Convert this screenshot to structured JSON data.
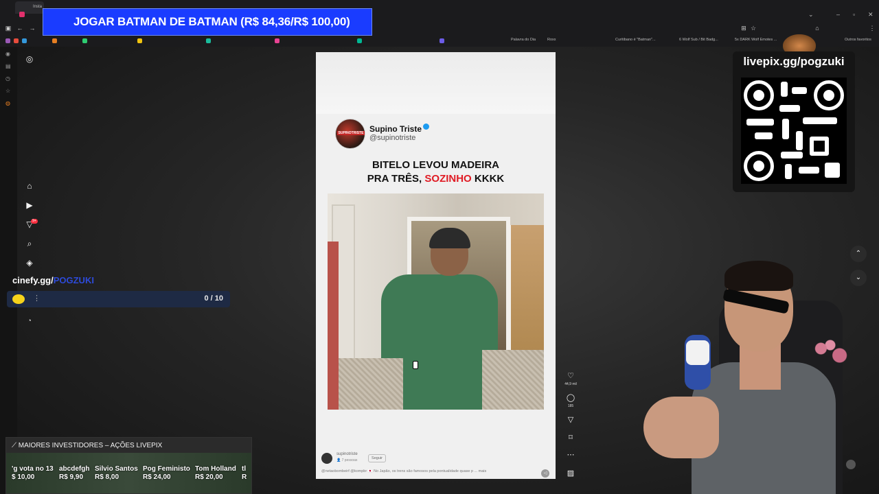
{
  "browser": {
    "tab_title": "Insta",
    "bookmarks": [
      "Palavra do Dia",
      "Roxx",
      "Curitibano é \"Batman\"...",
      "6 Wolf Sub / Bit Badg...",
      "5x DARK Wolf Emotes ...",
      "Outros favoritos"
    ]
  },
  "alert": {
    "text": "JOGAR BATMAN DE BATMAN (R$ 84,36/R$ 100,00)"
  },
  "overlay": {
    "cinefy_text": "cinefy.gg/",
    "cinefy_hidden": "POGZUKI",
    "goal_progress": "0  /  10",
    "qr_title": "livepix.gg/pogzuki"
  },
  "post": {
    "author_name": "Supino Triste",
    "author_handle": "@supinotriste",
    "avatar_text": "SUPINOTRISTE",
    "headline_line1": "BITELO LEVOU MADEIRA",
    "headline_line2_a": "PRA TRÊS, ",
    "headline_line2_red": "SOZINHO",
    "headline_line2_b": " KKKK",
    "footer_user": "supinotriste",
    "footer_sub": "👤 7 pessoas",
    "follow_label": "Seguir",
    "caption": "@netaobombeirf @kompbr 🇯🇵 No Japão, os trens são famosos pela pontualidade quase p ... mais"
  },
  "actions": {
    "like_count": "44,9 mil",
    "comment_count": "185"
  },
  "ticker": {
    "header": "MAIORES INVESTIDORES – AÇÕES LIVEPIX",
    "items": [
      {
        "name": "'g vota no 13",
        "value": "$ 10,00"
      },
      {
        "name": "abcdefgh",
        "value": "R$ 9,90"
      },
      {
        "name": "Silvio Santos",
        "value": "R$ 8,00"
      },
      {
        "name": "Pog Feministo",
        "value": "R$ 24,00"
      },
      {
        "name": "Tom Holland",
        "value": "R$ 20,00"
      },
      {
        "name": "tl",
        "value": "R"
      }
    ]
  },
  "colors": {
    "alert_bg": "#1a3cff",
    "headline_red": "#e01b24",
    "verified": "#1d9bf0",
    "goal_icon": "#f5d21b"
  }
}
